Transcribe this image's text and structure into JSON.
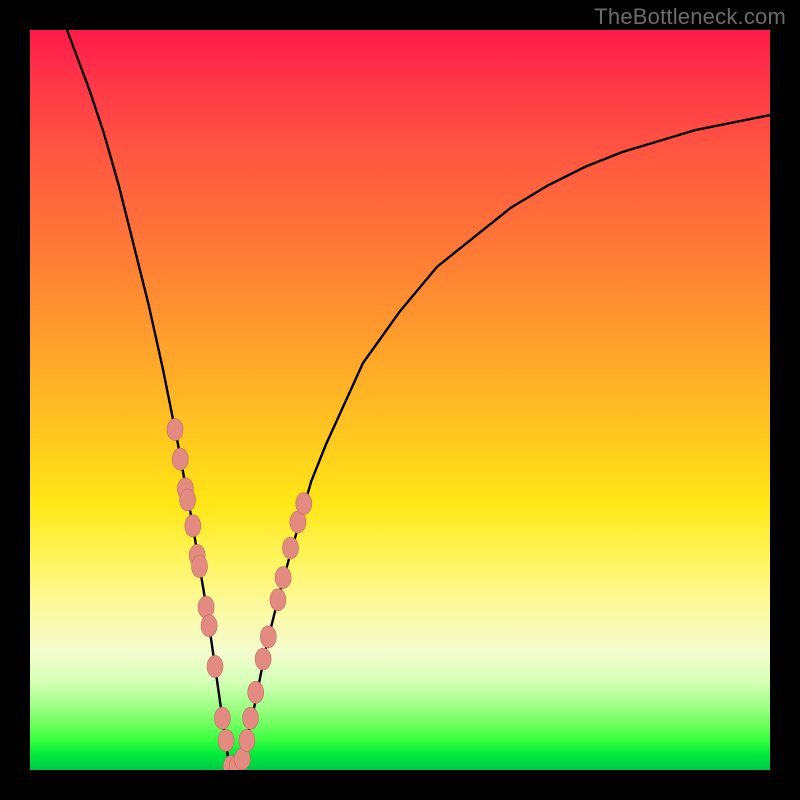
{
  "watermark": {
    "text": "TheBottleneck.com"
  },
  "colors": {
    "frame": "#000000",
    "curve": "#000000",
    "marker_fill": "#e38b81",
    "marker_stroke": "#c16a5f"
  },
  "chart_data": {
    "type": "line",
    "title": "",
    "xlabel": "",
    "ylabel": "",
    "xlim": [
      0,
      100
    ],
    "ylim": [
      0,
      100
    ],
    "grid": false,
    "note": "Axes are unlabeled in the source image; x/y are normalized 0–100. Curve shows bottleneck-percentage style V-shape with minimum near x≈27; background gradient encodes bottleneck severity (red=high, green=low). Values estimated visually.",
    "series": [
      {
        "name": "bottleneck-curve",
        "x": [
          5,
          8,
          10,
          12,
          14,
          16,
          18,
          20,
          22,
          23,
          24,
          25,
          26,
          27,
          28,
          29,
          30,
          31,
          32,
          34,
          36,
          38,
          40,
          45,
          50,
          55,
          60,
          65,
          70,
          75,
          80,
          85,
          90,
          95,
          100
        ],
        "y": [
          100,
          92,
          86,
          79,
          71,
          63,
          54,
          44,
          33,
          27,
          21,
          14,
          7,
          0,
          0,
          3,
          7,
          12,
          17,
          25,
          32,
          39,
          44,
          55,
          62,
          68,
          72,
          76,
          79,
          81.5,
          83.5,
          85,
          86.5,
          87.5,
          88.5
        ]
      }
    ],
    "markers": {
      "name": "highlighted-points",
      "points_xy": [
        [
          19.6,
          46
        ],
        [
          20.3,
          42
        ],
        [
          21.0,
          38
        ],
        [
          21.3,
          36.5
        ],
        [
          22.0,
          33
        ],
        [
          22.6,
          29
        ],
        [
          22.9,
          27.5
        ],
        [
          23.8,
          22
        ],
        [
          24.2,
          19.5
        ],
        [
          25.0,
          14
        ],
        [
          26.0,
          7
        ],
        [
          26.5,
          4
        ],
        [
          27.2,
          0.5
        ],
        [
          28.0,
          0.5
        ],
        [
          28.7,
          1.5
        ],
        [
          29.3,
          4
        ],
        [
          29.8,
          7
        ],
        [
          30.5,
          10.5
        ],
        [
          31.5,
          15
        ],
        [
          32.2,
          18
        ],
        [
          33.5,
          23
        ],
        [
          34.2,
          26
        ],
        [
          35.2,
          30
        ],
        [
          36.2,
          33.5
        ],
        [
          37.0,
          36
        ]
      ]
    },
    "gradient_stops": [
      {
        "pos": 0,
        "color": "#ff1a4b",
        "meaning": "severe bottleneck"
      },
      {
        "pos": 50,
        "color": "#ffc81f",
        "meaning": "moderate"
      },
      {
        "pos": 78,
        "color": "#fcfa9e",
        "meaning": "light"
      },
      {
        "pos": 100,
        "color": "#00c94a",
        "meaning": "balanced"
      }
    ]
  }
}
